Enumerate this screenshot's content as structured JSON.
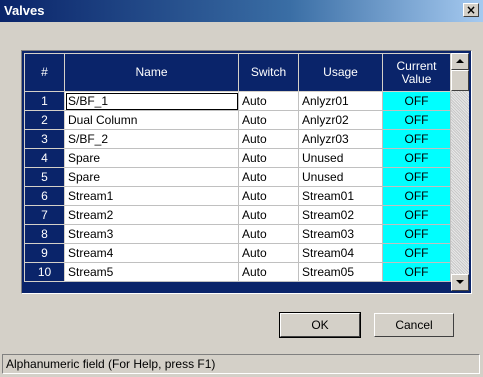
{
  "window": {
    "title": "Valves",
    "close_label": "×"
  },
  "table": {
    "columns": [
      "#",
      "Name",
      "Switch",
      "Usage",
      "Current Value"
    ],
    "rows": [
      {
        "num": "1",
        "name": "S/BF_1",
        "switch": "Auto",
        "usage": "Anlyzr01",
        "value": "OFF"
      },
      {
        "num": "2",
        "name": "Dual Column",
        "switch": "Auto",
        "usage": "Anlyzr02",
        "value": "OFF"
      },
      {
        "num": "3",
        "name": "S/BF_2",
        "switch": "Auto",
        "usage": "Anlyzr03",
        "value": "OFF"
      },
      {
        "num": "4",
        "name": "Spare",
        "switch": "Auto",
        "usage": "Unused",
        "value": "OFF"
      },
      {
        "num": "5",
        "name": "Spare",
        "switch": "Auto",
        "usage": "Unused",
        "value": "OFF"
      },
      {
        "num": "6",
        "name": "Stream1",
        "switch": "Auto",
        "usage": "Stream01",
        "value": "OFF"
      },
      {
        "num": "7",
        "name": "Stream2",
        "switch": "Auto",
        "usage": "Stream02",
        "value": "OFF"
      },
      {
        "num": "8",
        "name": "Stream3",
        "switch": "Auto",
        "usage": "Stream03",
        "value": "OFF"
      },
      {
        "num": "9",
        "name": "Stream4",
        "switch": "Auto",
        "usage": "Stream04",
        "value": "OFF"
      },
      {
        "num": "10",
        "name": "Stream5",
        "switch": "Auto",
        "usage": "Stream05",
        "value": "OFF"
      }
    ]
  },
  "buttons": {
    "ok_label": "OK",
    "cancel_label": "Cancel"
  },
  "status": {
    "text": "Alphanumeric field (For Help, press F1)"
  },
  "colors": {
    "header_bg": "#0a246a",
    "value_bg": "#00ffff",
    "window_bg": "#d4d0c8"
  }
}
